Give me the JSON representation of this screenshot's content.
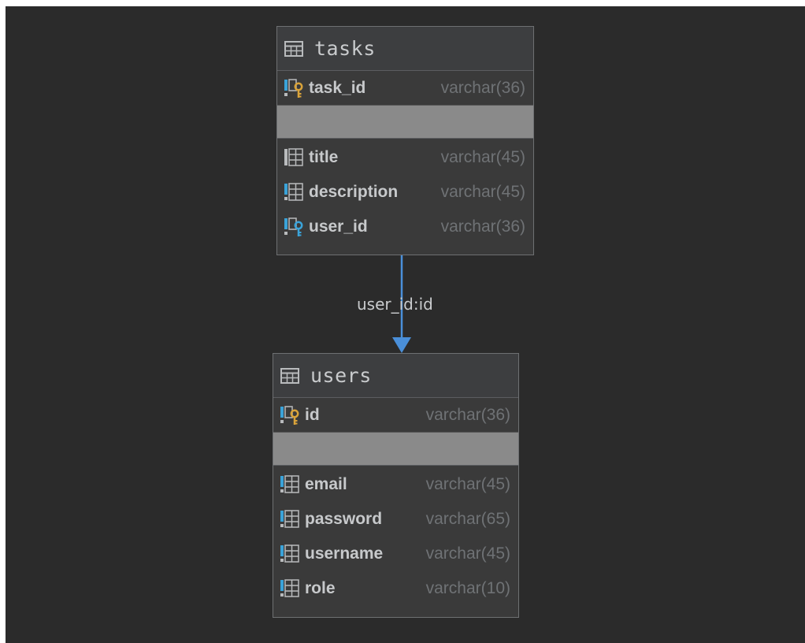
{
  "tables": {
    "tasks": {
      "name": "tasks",
      "primary_key": {
        "name": "task_id",
        "type": "varchar(36)"
      },
      "columns": [
        {
          "name": "title",
          "type": "varchar(45)"
        },
        {
          "name": "description",
          "type": "varchar(45)"
        },
        {
          "name": "user_id",
          "type": "varchar(36)"
        }
      ]
    },
    "users": {
      "name": "users",
      "primary_key": {
        "name": "id",
        "type": "varchar(36)"
      },
      "columns": [
        {
          "name": "email",
          "type": "varchar(45)"
        },
        {
          "name": "password",
          "type": "varchar(65)"
        },
        {
          "name": "username",
          "type": "varchar(45)"
        },
        {
          "name": "role",
          "type": "varchar(10)"
        }
      ]
    }
  },
  "relation": {
    "label": "user_id:id",
    "from": "tasks",
    "to": "users"
  },
  "icons": {
    "table": "table-icon",
    "primary_key": "primary-key-column-icon",
    "foreign_key": "foreign-key-column-icon",
    "column": "column-icon"
  },
  "colors": {
    "background": "#2b2b2b",
    "arrow": "#4a8fd9",
    "key_gold": "#d9a33a",
    "key_blue": "#3aa3d9"
  }
}
